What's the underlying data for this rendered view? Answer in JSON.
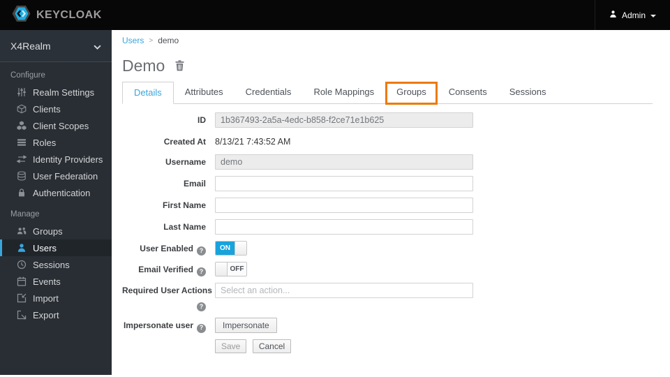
{
  "icons": {
    "help": "?",
    "breadcrumb_separator": ">"
  },
  "colors": {
    "accent": "#39a5dc",
    "annotation": "#ec7a08",
    "toggle_on": "#18a3dd",
    "topbar_bg": "#070707",
    "sidebar_bg": "#292e34"
  },
  "topbar": {
    "brand": "KEYCLOAK",
    "user": "Admin"
  },
  "sidebar": {
    "realm": "X4Realm",
    "sections": [
      {
        "label": "Configure",
        "items": [
          {
            "label": "Realm Settings",
            "icon": "sliders-icon"
          },
          {
            "label": "Clients",
            "icon": "cube-icon"
          },
          {
            "label": "Client Scopes",
            "icon": "cubes-icon"
          },
          {
            "label": "Roles",
            "icon": "list-icon"
          },
          {
            "label": "Identity Providers",
            "icon": "exchange-icon"
          },
          {
            "label": "User Federation",
            "icon": "database-icon"
          },
          {
            "label": "Authentication",
            "icon": "lock-icon"
          }
        ]
      },
      {
        "label": "Manage",
        "items": [
          {
            "label": "Groups",
            "icon": "groups-icon"
          },
          {
            "label": "Users",
            "icon": "user-icon",
            "selected": true
          },
          {
            "label": "Sessions",
            "icon": "clock-icon"
          },
          {
            "label": "Events",
            "icon": "calendar-icon"
          },
          {
            "label": "Import",
            "icon": "import-icon"
          },
          {
            "label": "Export",
            "icon": "export-icon"
          }
        ]
      }
    ]
  },
  "breadcrumb": {
    "parent": "Users",
    "current": "demo"
  },
  "page": {
    "title": "Demo"
  },
  "tabs": [
    {
      "label": "Details",
      "active": true
    },
    {
      "label": "Attributes"
    },
    {
      "label": "Credentials"
    },
    {
      "label": "Role Mappings"
    },
    {
      "label": "Groups",
      "annotated": true
    },
    {
      "label": "Consents"
    },
    {
      "label": "Sessions"
    }
  ],
  "form": {
    "id": {
      "label": "ID",
      "value": "1b367493-2a5a-4edc-b858-f2ce71e1b625"
    },
    "created_at": {
      "label": "Created At",
      "value": "8/13/21 7:43:52 AM"
    },
    "username": {
      "label": "Username",
      "value": "demo"
    },
    "email": {
      "label": "Email",
      "value": ""
    },
    "first_name": {
      "label": "First Name",
      "value": ""
    },
    "last_name": {
      "label": "Last Name",
      "value": ""
    },
    "user_enabled": {
      "label": "User Enabled",
      "state": "ON"
    },
    "email_verified": {
      "label": "Email Verified",
      "state": "OFF"
    },
    "required_user_actions": {
      "label": "Required User Actions",
      "placeholder": "Select an action..."
    },
    "impersonate": {
      "label": "Impersonate user",
      "button": "Impersonate"
    },
    "actions": {
      "save": "Save",
      "cancel": "Cancel"
    }
  }
}
